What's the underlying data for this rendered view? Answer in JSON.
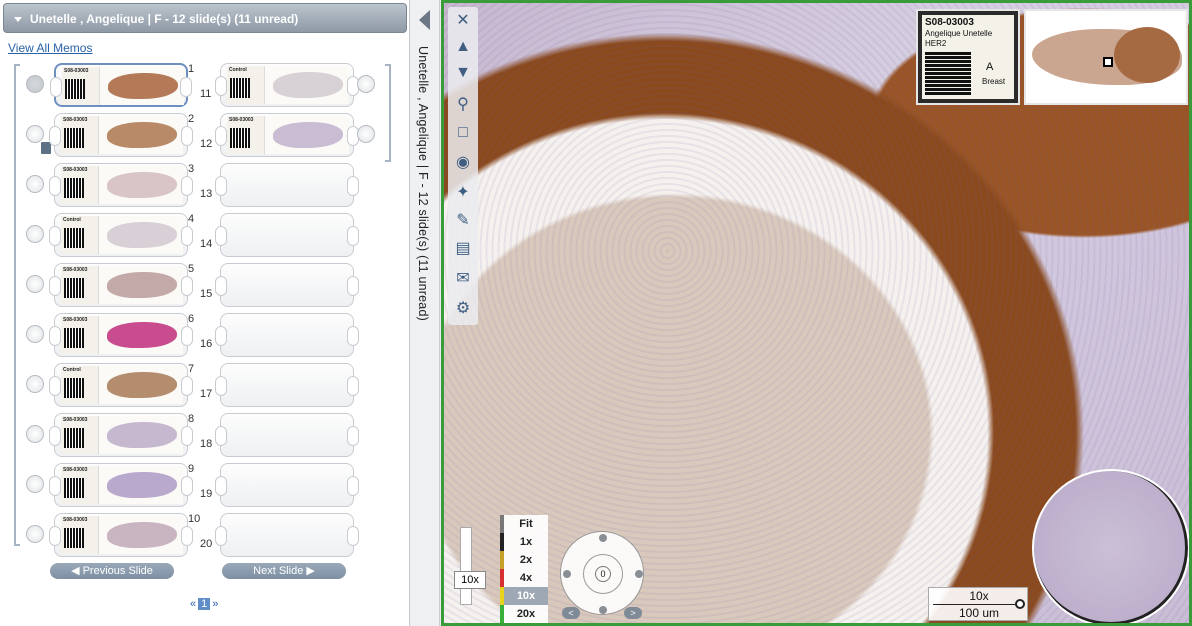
{
  "panel": {
    "header_title": "Unetelle , Angelique | F - 12 slide(s) (11 unread)",
    "view_all_memos": "View All Memos",
    "prev_label": "Previous Slide",
    "next_label": "Next Slide",
    "pager": {
      "prev": "«",
      "current": "1",
      "next": "»"
    }
  },
  "vertical_tab": {
    "text": "Unetelle , Angelique | F - 12 slide(s) (11 unread)"
  },
  "slides": [
    {
      "num": "1",
      "label_top": "S08-03003",
      "tissue": "#b47a58"
    },
    {
      "num": "2",
      "label_top": "S08-03003",
      "tissue": "#b98a68"
    },
    {
      "num": "3",
      "label_top": "S08-03003",
      "tissue": "#d9c4c7"
    },
    {
      "num": "4",
      "label_top": "Control",
      "tissue": "#d8d0d6"
    },
    {
      "num": "5",
      "label_top": "S08-03003",
      "tissue": "#c4a9a9"
    },
    {
      "num": "6",
      "label_top": "S08-03003",
      "tissue": "#c84c8e"
    },
    {
      "num": "7",
      "label_top": "Control",
      "tissue": "#b38d6e"
    },
    {
      "num": "8",
      "label_top": "S08-03003",
      "tissue": "#c5b8cf"
    },
    {
      "num": "9",
      "label_top": "S08-03003",
      "tissue": "#b9a9cc"
    },
    {
      "num": "10",
      "label_top": "S08-03003",
      "tissue": "#c9b5c2"
    },
    {
      "num": "11",
      "label_top": "Control",
      "tissue": "#d8d2d6"
    },
    {
      "num": "12",
      "label_top": "S08-03003",
      "tissue": "#c9bcd3"
    },
    {
      "num": "13"
    },
    {
      "num": "14"
    },
    {
      "num": "15"
    },
    {
      "num": "16"
    },
    {
      "num": "17"
    },
    {
      "num": "18"
    },
    {
      "num": "19"
    },
    {
      "num": "20"
    }
  ],
  "viewer": {
    "label": {
      "line1": "S08-03003",
      "line2": "Angelique Unetelle",
      "line3": "HER2",
      "line4": "A",
      "line5": "Breast"
    },
    "zoom_current": "10x",
    "zoom_levels": [
      {
        "label": "Fit",
        "color": "#777777"
      },
      {
        "label": "1x",
        "color": "#222222"
      },
      {
        "label": "2x",
        "color": "#c8a12a"
      },
      {
        "label": "4x",
        "color": "#d83030"
      },
      {
        "label": "10x",
        "color": "#e7d21e",
        "active": true
      },
      {
        "label": "20x",
        "color": "#3ab03a"
      }
    ],
    "rotation": "0",
    "rot_left": "<",
    "rot_right": ">",
    "scale_mag": "10x",
    "scale_len": "100 um"
  }
}
